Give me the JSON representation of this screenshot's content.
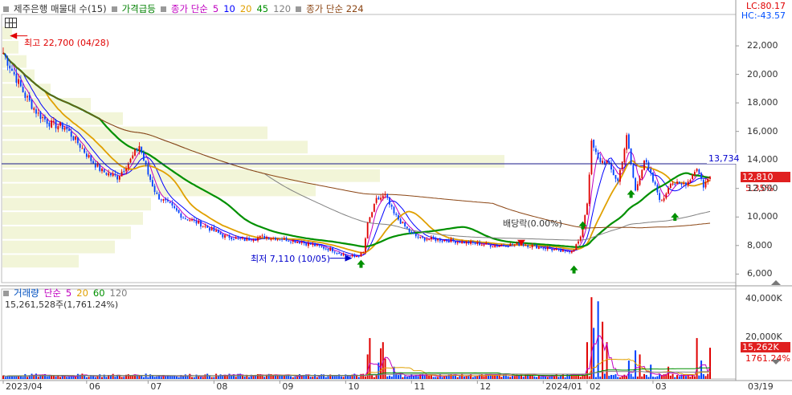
{
  "price_legend": {
    "title": "제주은행 매물대 수(15)",
    "item2": "가격급등",
    "ma_label": "종가 단순",
    "ma_periods": [
      "5",
      "10",
      "20",
      "45",
      "120"
    ],
    "ma_colors": [
      "#c000c0",
      "#0000ff",
      "#e0a000",
      "#009000",
      "#808080"
    ],
    "ma2_label": "종가 단순 224",
    "ma2_color": "#8b4513"
  },
  "lc_hc": {
    "lc": "LC:80.17",
    "hc": "HC:-43.57"
  },
  "annotations": {
    "high": "최고 22,700 (04/28)",
    "low": "최저 7,110 (10/05)",
    "dividend": "배당락(0.00%)",
    "hline_value": "13,734",
    "current_price": "12,810",
    "current_pct": "5.35%"
  },
  "price_axis": [
    "22,000",
    "20,000",
    "18,000",
    "16,000",
    "14,000",
    "12,000",
    "10,000",
    "8,000",
    "6,000"
  ],
  "volume_legend": {
    "label": "거래량",
    "ma_label": "단순",
    "periods": [
      "5",
      "20",
      "60",
      "120"
    ],
    "colors": [
      "#c000c0",
      "#e0a000",
      "#009000",
      "#808080"
    ],
    "info": "15,261,528주(1,761.24%)"
  },
  "volume_axis": [
    "40,000K",
    "20,000K"
  ],
  "volume_tags": {
    "current": "15,262K",
    "pct": "1761.24%"
  },
  "x_axis": [
    "2023/04",
    "06",
    "07",
    "08",
    "09",
    "10",
    "11",
    "12",
    "2024/01",
    "02",
    "03",
    "03/19"
  ],
  "chart_data": {
    "type": "candlestick",
    "price_ylim": [
      5400,
      24200
    ],
    "volume_ylim": [
      0,
      44000
    ],
    "x_labels": [
      "2023/04",
      "06",
      "07",
      "08",
      "09",
      "10",
      "11",
      "12",
      "2024/01",
      "02",
      "03"
    ],
    "close_anchors": [
      [
        0,
        21500
      ],
      [
        5,
        20000
      ],
      [
        10,
        18500
      ],
      [
        16,
        17200
      ],
      [
        22,
        16500
      ],
      [
        28,
        16300
      ],
      [
        34,
        15200
      ],
      [
        40,
        14000
      ],
      [
        45,
        13200
      ],
      [
        52,
        12800
      ],
      [
        58,
        14000
      ],
      [
        62,
        15000
      ],
      [
        66,
        13000
      ],
      [
        70,
        11500
      ],
      [
        76,
        10800
      ],
      [
        82,
        10000
      ],
      [
        90,
        9500
      ],
      [
        100,
        8700
      ],
      [
        110,
        8400
      ],
      [
        118,
        8600
      ],
      [
        126,
        8500
      ],
      [
        134,
        8300
      ],
      [
        142,
        8000
      ],
      [
        150,
        7700
      ],
      [
        156,
        7300
      ],
      [
        160,
        7200
      ],
      [
        164,
        7500
      ],
      [
        166,
        9500
      ],
      [
        170,
        11200
      ],
      [
        174,
        11500
      ],
      [
        178,
        10200
      ],
      [
        182,
        9500
      ],
      [
        186,
        8800
      ],
      [
        190,
        8500
      ],
      [
        200,
        8400
      ],
      [
        212,
        8200
      ],
      [
        224,
        8000
      ],
      [
        236,
        8100
      ],
      [
        248,
        7800
      ],
      [
        256,
        7500
      ],
      [
        260,
        7800
      ],
      [
        263,
        8500
      ],
      [
        266,
        11000
      ],
      [
        268,
        15200
      ],
      [
        271,
        14000
      ],
      [
        275,
        13800
      ],
      [
        280,
        12500
      ],
      [
        284,
        15600
      ],
      [
        288,
        11800
      ],
      [
        292,
        14000
      ],
      [
        296,
        12500
      ],
      [
        300,
        11000
      ],
      [
        304,
        12500
      ],
      [
        308,
        12200
      ],
      [
        312,
        12500
      ],
      [
        316,
        13500
      ],
      [
        319,
        12200
      ],
      [
        322,
        12810
      ]
    ],
    "volume_spikes": [
      [
        166,
        12000
      ],
      [
        167,
        20000
      ],
      [
        171,
        8000
      ],
      [
        172,
        15000
      ],
      [
        173,
        18000
      ],
      [
        174,
        10000
      ],
      [
        178,
        6000
      ],
      [
        266,
        18000
      ],
      [
        268,
        40000
      ],
      [
        269,
        25000
      ],
      [
        271,
        38000
      ],
      [
        273,
        28000
      ],
      [
        275,
        18000
      ],
      [
        285,
        9000
      ],
      [
        288,
        14000
      ],
      [
        290,
        12000
      ],
      [
        295,
        7000
      ],
      [
        303,
        6000
      ],
      [
        316,
        20000
      ],
      [
        318,
        9000
      ],
      [
        322,
        15262
      ]
    ],
    "price_ma_periods": [
      5,
      10,
      20,
      45,
      120,
      224
    ],
    "volume_ma_periods": [
      5,
      20,
      60,
      120
    ]
  }
}
